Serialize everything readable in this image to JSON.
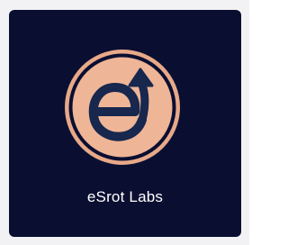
{
  "brand": {
    "name": "eSrot Labs",
    "logo_icon": "esrot-labs-logo-icon"
  },
  "colors": {
    "background": "#0a0f31",
    "accent": "#efb597",
    "ring": "#e8a989",
    "glyph": "#17274e",
    "text": "#ffffff",
    "outer": "#f2f2f4"
  }
}
